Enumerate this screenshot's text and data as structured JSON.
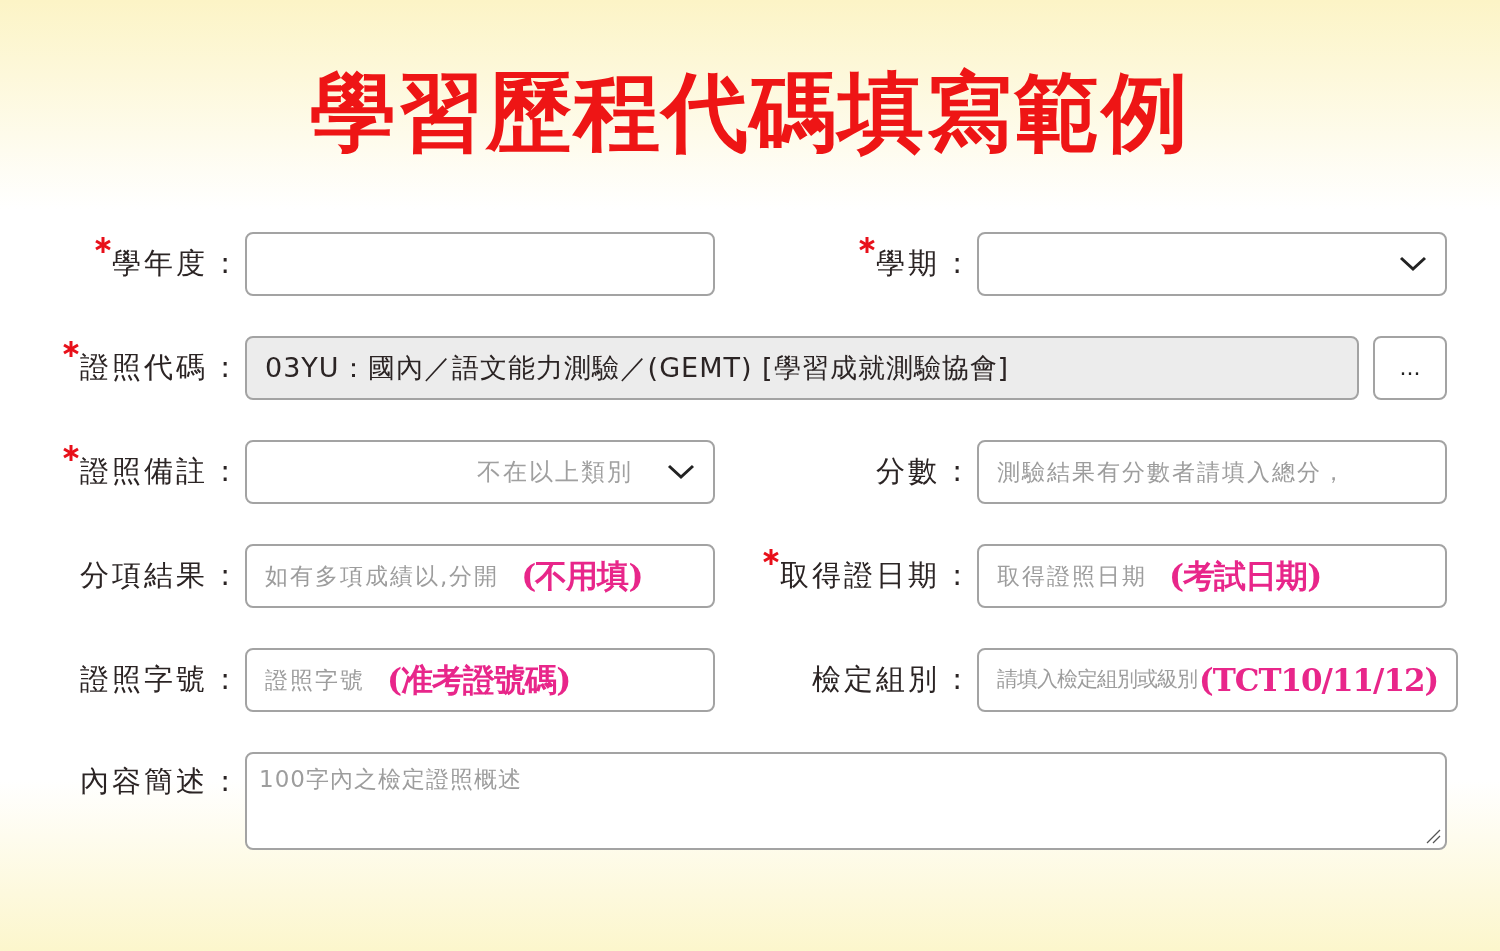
{
  "title": "學習歷程代碼填寫範例",
  "rows": [
    {
      "fields": [
        {
          "label": "學年度 :",
          "required": true,
          "kind": "text"
        },
        {
          "label": "學期 :",
          "required": true,
          "kind": "select"
        }
      ]
    },
    {
      "fields": [
        {
          "label": "證照代碼 :",
          "required": true,
          "kind": "readonly",
          "value": "03YU：國內／語文能力測驗／(GEMT) [學習成就測驗協會]",
          "button": "..."
        }
      ]
    },
    {
      "fields": [
        {
          "label": "證照備註 :",
          "required": true,
          "kind": "select",
          "value": "不在以上類別"
        },
        {
          "label": "分數 :",
          "required": false,
          "kind": "text",
          "placeholder": "測驗結果有分數者請填入總分，"
        }
      ]
    },
    {
      "fields": [
        {
          "label": "分項結果 :",
          "required": false,
          "kind": "text",
          "placeholder": "如有多項成績以,分開",
          "note": "(不用填)"
        },
        {
          "label": "取得證日期 :",
          "required": true,
          "kind": "text",
          "placeholder": "取得證照日期",
          "note": "(考試日期)"
        }
      ]
    },
    {
      "fields": [
        {
          "label": "證照字號 :",
          "required": false,
          "kind": "text",
          "placeholder": "證照字號",
          "note": "(准考證號碼)"
        },
        {
          "label": "檢定組別 :",
          "required": false,
          "kind": "text",
          "placeholder": "請填入檢定組別或級別",
          "note": "(TCT10/11/12)",
          "compact": true
        }
      ]
    },
    {
      "fields": [
        {
          "label": "內容簡述 :",
          "required": false,
          "kind": "textarea",
          "placeholder": "100字內之檢定證照概述"
        }
      ]
    }
  ]
}
